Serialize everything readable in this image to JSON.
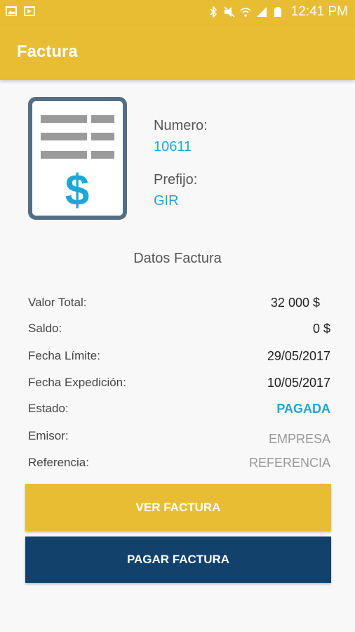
{
  "statusbar": {
    "time": "12:41 PM"
  },
  "appbar": {
    "title": "Factura"
  },
  "invoice": {
    "numero_label": "Numero:",
    "numero_value": "10611",
    "prefijo_label": "Prefijo:",
    "prefijo_value": "GIR"
  },
  "details": {
    "title": "Datos Factura",
    "rows": [
      {
        "label": "Valor Total:",
        "value": "32 000 $"
      },
      {
        "label": "Saldo:",
        "value": "0 $"
      },
      {
        "label": "Fecha Límite:",
        "value": "29/05/2017"
      },
      {
        "label": "Fecha Expedición:",
        "value": "10/05/2017"
      },
      {
        "label": "Estado:",
        "value": "PAGADA"
      },
      {
        "label": "Emisor:",
        "value": "EMPRESA"
      },
      {
        "label": "Referencia:",
        "value": "REFERENCIA"
      }
    ]
  },
  "buttons": {
    "ver": "VER FACTURA",
    "pagar": "PAGAR FACTURA"
  },
  "colors": {
    "accent": "#e8bd34",
    "primary_dark": "#12426b",
    "link": "#1ea7d6"
  }
}
